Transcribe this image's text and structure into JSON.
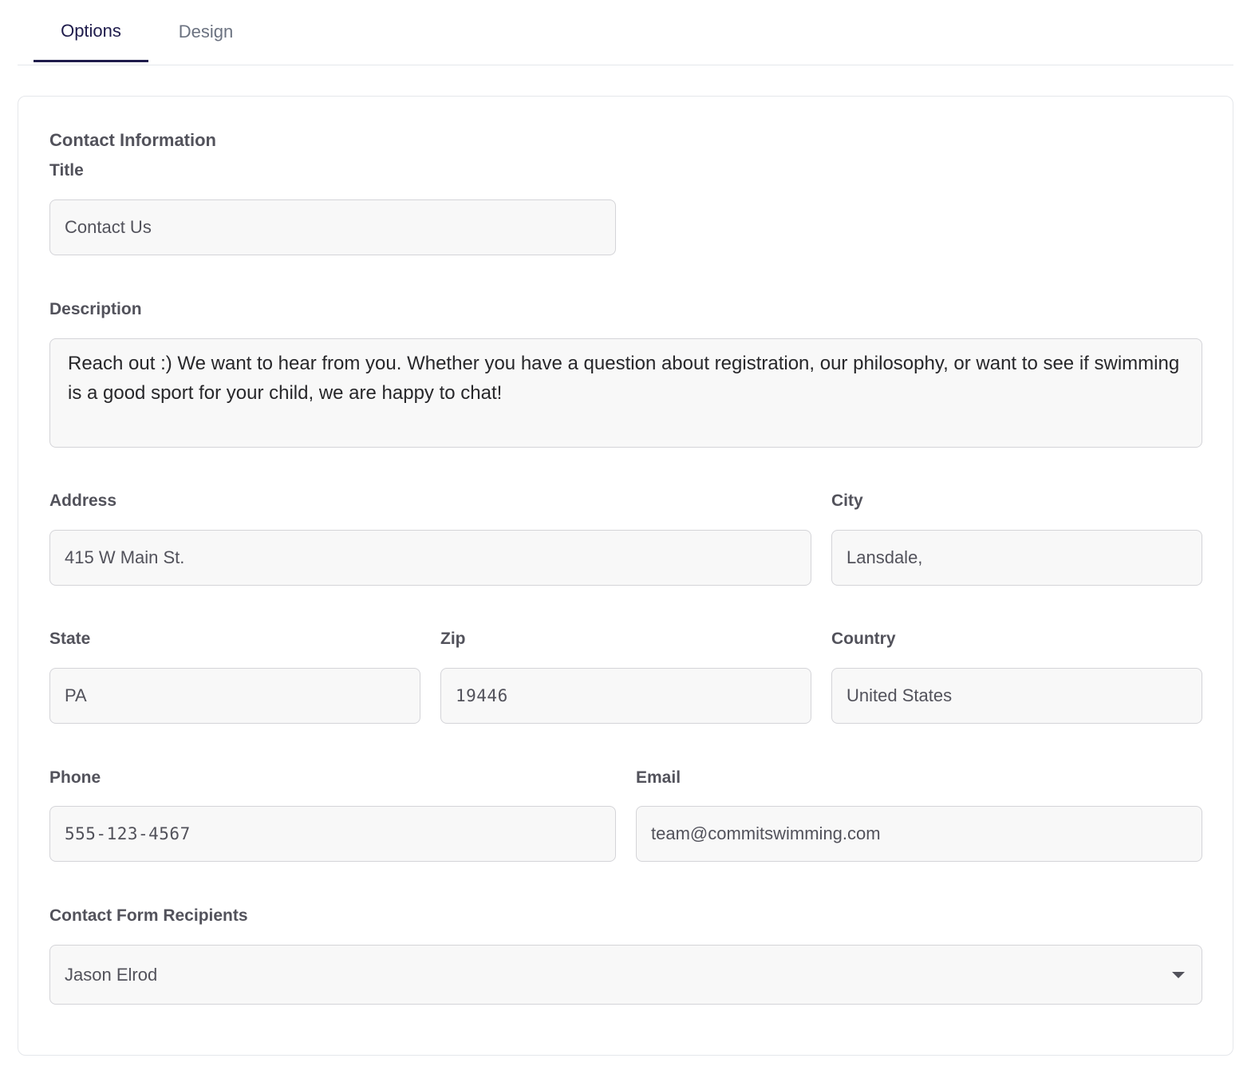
{
  "tabs": [
    {
      "label": "Options",
      "active": true
    },
    {
      "label": "Design",
      "active": false
    }
  ],
  "section": {
    "title": "Contact Information"
  },
  "fields": {
    "title": {
      "label": "Title",
      "value": "Contact Us"
    },
    "description": {
      "label": "Description",
      "value": "Reach out :) We want to hear from you. Whether you have a question about registration, our philosophy, or want to see if swimming is a good sport for your child, we are happy to chat!"
    },
    "address": {
      "label": "Address",
      "value": "415 W Main St."
    },
    "city": {
      "label": "City",
      "value": "Lansdale,"
    },
    "state": {
      "label": "State",
      "value": "PA"
    },
    "zip": {
      "label": "Zip",
      "value": "19446"
    },
    "country": {
      "label": "Country",
      "value": "United States"
    },
    "phone": {
      "label": "Phone",
      "value": "555-123-4567"
    },
    "email": {
      "label": "Email",
      "value": "team@commitswimming.com"
    },
    "recipients": {
      "label": "Contact Form Recipients",
      "value": "Jason Elrod",
      "icon": "chevron-down-icon"
    }
  },
  "colors": {
    "active_tab": "#1e1b4b",
    "inactive_tab": "#6b7280",
    "field_bg": "#f8f8f8",
    "field_border": "#d4d4d8"
  }
}
